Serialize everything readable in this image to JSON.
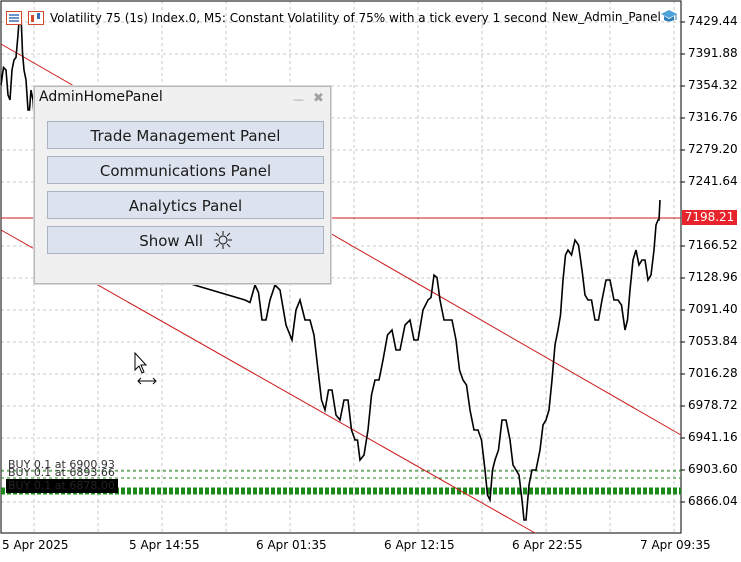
{
  "header": {
    "chart_title": "Volatility 75 (1s) Index.0, M5:  Constant Volatility of 75% with a tick every 1 second",
    "ea_name": "New_Admin_Panel"
  },
  "price_axis": {
    "labels": [
      "7429.44",
      "7391.88",
      "7354.32",
      "7316.76",
      "7279.20",
      "7241.64",
      "7166.52",
      "7128.96",
      "7091.40",
      "7053.84",
      "7016.28",
      "6978.72",
      "6941.16",
      "6903.60",
      "6866.04"
    ],
    "current_price": "7198.21",
    "current_price_color": "#e8232b"
  },
  "time_axis": {
    "labels": [
      "5 Apr 2025",
      "5 Apr 14:55",
      "6 Apr 01:35",
      "6 Apr 12:15",
      "6 Apr 22:55",
      "7 Apr 09:35"
    ]
  },
  "orders": {
    "labels": [
      "BUY 0.1 at 6900.93",
      "BUY 0.1 at 6893.66",
      "BUY 0.1 at 6878.00"
    ],
    "line_color": "#1a8a1a"
  },
  "panel": {
    "title": "AdminHomePanel",
    "minimize": "—",
    "close": "✖",
    "buttons": {
      "trade": "Trade Management Panel",
      "comms": "Communications Panel",
      "analytics": "Analytics Panel",
      "show_all": "Show All"
    }
  },
  "colors": {
    "trendline": "#cc1a1a",
    "candles": "#000000",
    "grid": "#c8c8c8"
  }
}
